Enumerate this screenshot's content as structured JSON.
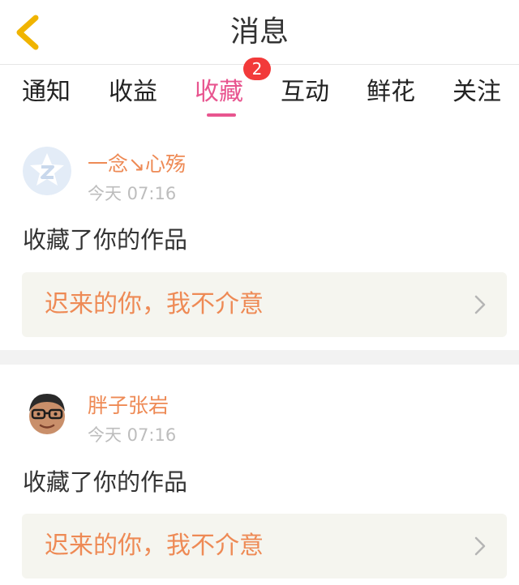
{
  "header": {
    "title": "消息",
    "back_icon": "chevron-left-icon"
  },
  "tabs": [
    {
      "label": "通知"
    },
    {
      "label": "收益"
    },
    {
      "label": "收藏",
      "active": true,
      "badge": "2"
    },
    {
      "label": "互动"
    },
    {
      "label": "鲜花"
    },
    {
      "label": "关注"
    }
  ],
  "messages": [
    {
      "username": "一念↘心殇",
      "time": "今天 07:16",
      "action": "收藏了你的作品",
      "work_title": "迟来的你，我不介意",
      "avatar_icon": "default-z-avatar-icon"
    },
    {
      "username": "胖子张岩",
      "time": "今天 07:16",
      "action": "收藏了你的作品",
      "work_title": "迟来的你，我不介意",
      "avatar_icon": "cartoon-face-avatar-icon"
    }
  ],
  "colors": {
    "accent": "#e8558f",
    "username": "#ee8a55",
    "badge": "#f23a3a",
    "back_icon": "#f0b400"
  }
}
